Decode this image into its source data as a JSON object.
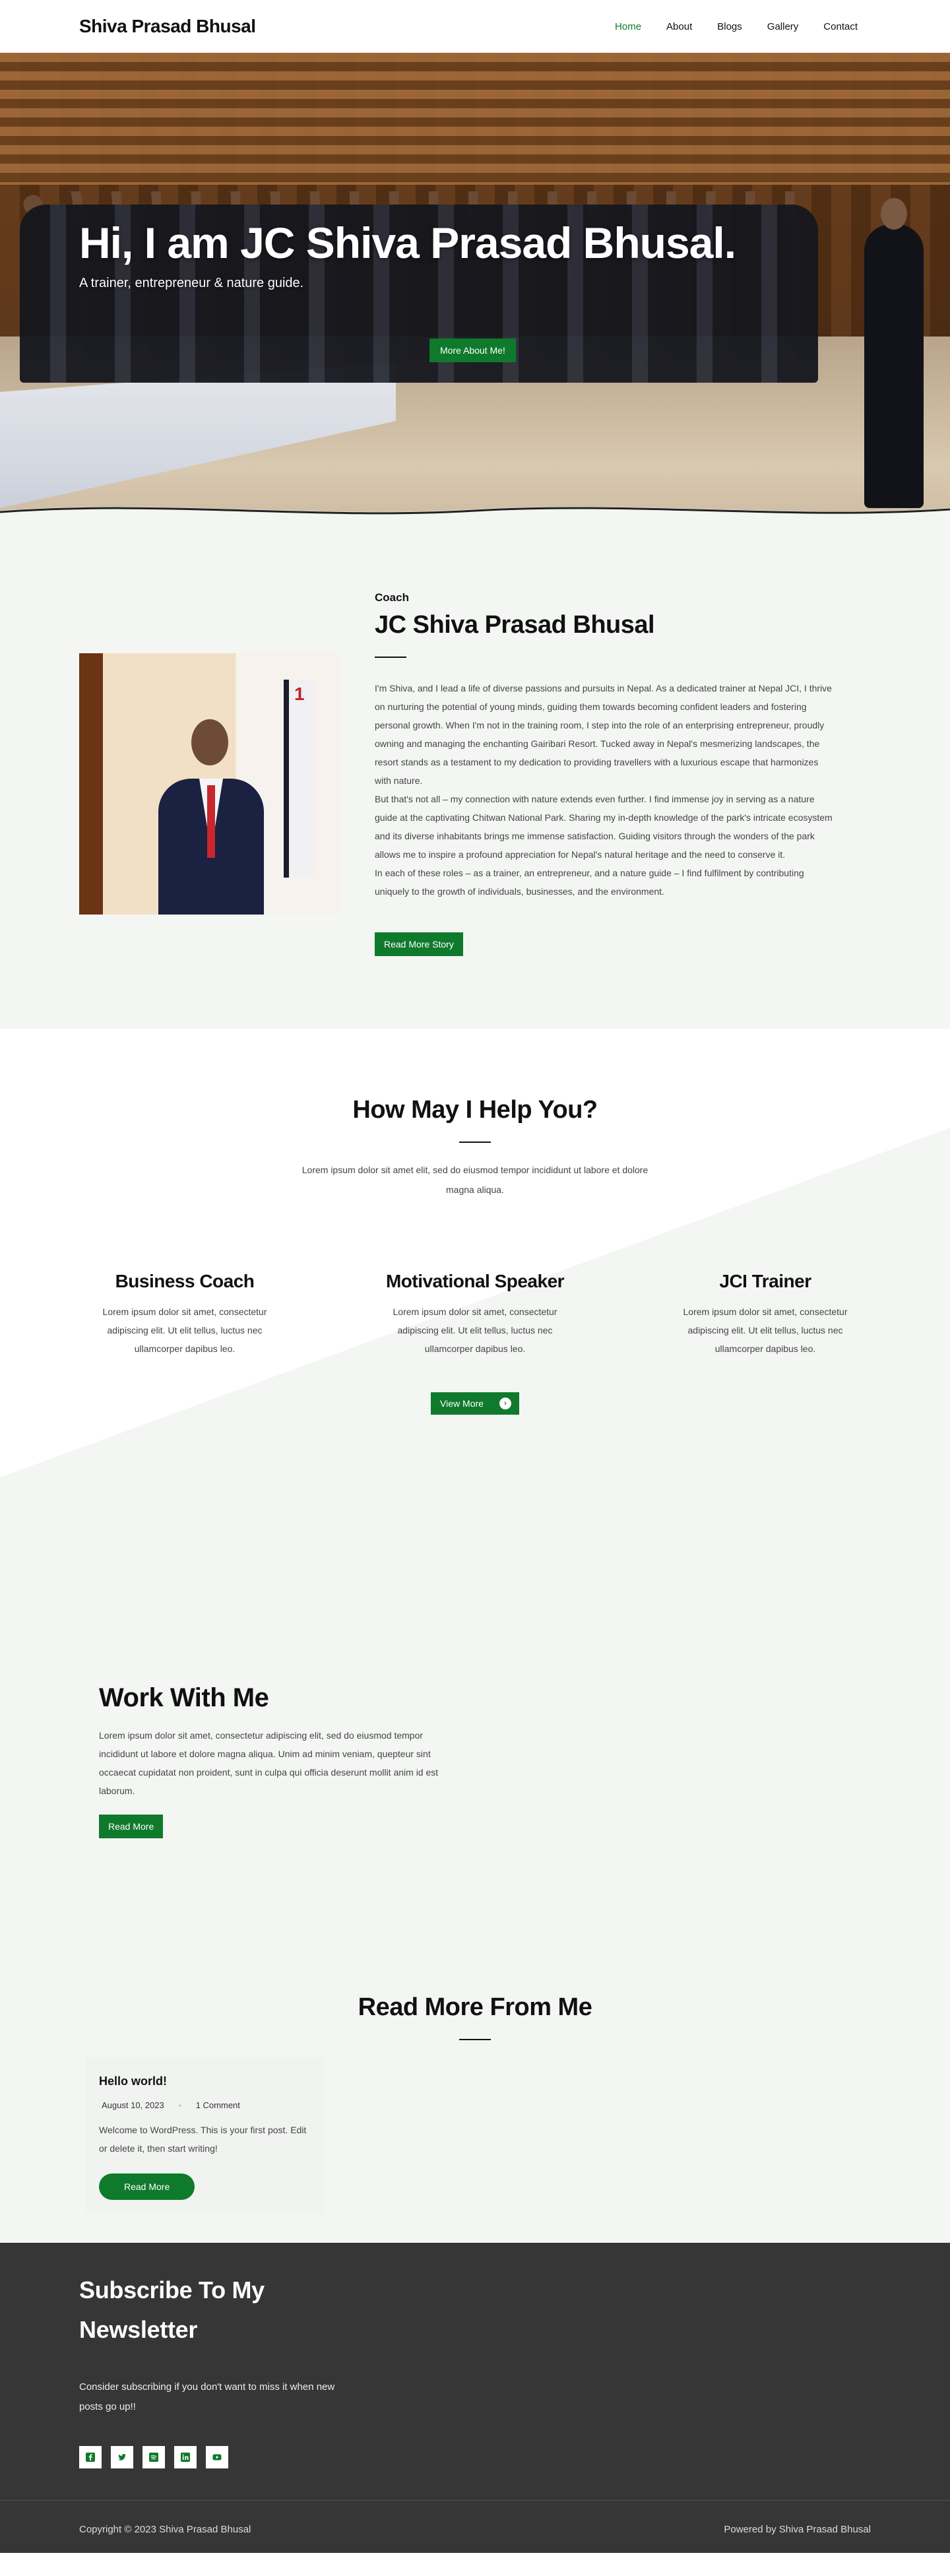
{
  "header": {
    "brand": "Shiva Prasad Bhusal",
    "nav": [
      "Home",
      "About",
      "Blogs",
      "Gallery",
      "Contact"
    ]
  },
  "hero": {
    "title": "Hi, I am JC Shiva Prasad Bhusal.",
    "subtitle": "A trainer, entrepreneur & nature guide.",
    "button": "More About Me!"
  },
  "about": {
    "kicker": "Coach",
    "title": "JC Shiva Prasad Bhusal",
    "paragraphs": [
      "I'm Shiva, and I lead a life of diverse passions and pursuits in Nepal. As a dedicated trainer at Nepal JCI, I thrive on nurturing the potential of young minds, guiding them towards becoming confident leaders and fostering personal growth. When I'm not in the training room, I step into the role of an enterprising entrepreneur, proudly owning and managing the enchanting Gairibari Resort. Tucked away in Nepal's mesmerizing landscapes, the resort stands as a testament to my dedication to providing travellers with a luxurious escape that harmonizes with nature.",
      "But that's not all – my connection with nature extends even further. I find immense joy in serving as a nature guide at the captivating Chitwan National Park. Sharing my in-depth knowledge of the park's intricate ecosystem and its diverse inhabitants brings me immense satisfaction. Guiding visitors through the wonders of the park allows me to inspire a profound appreciation for Nepal's natural heritage and the need to conserve it.",
      "In each of these roles – as a trainer, an entrepreneur, and a nature guide – I find fulfilment by contributing uniquely to the growth of individuals, businesses, and the environment."
    ],
    "button": "Read More Story"
  },
  "help": {
    "title": "How May I Help You?",
    "description": "Lorem ipsum dolor sit amet elit, sed do eiusmod tempor incididunt ut labore et dolore magna aliqua.",
    "services": [
      {
        "title": "Business Coach",
        "text": "Lorem ipsum dolor sit amet, consectetur adipiscing elit. Ut elit tellus, luctus nec ullamcorper dapibus leo."
      },
      {
        "title": "Motivational Speaker",
        "text": "Lorem ipsum dolor sit amet, consectetur adipiscing elit. Ut elit tellus, luctus nec ullamcorper dapibus leo."
      },
      {
        "title": "JCI Trainer",
        "text": "Lorem ipsum dolor sit amet, consectetur adipiscing elit. Ut elit tellus, luctus nec ullamcorper dapibus leo."
      }
    ],
    "button": "View More"
  },
  "work": {
    "title": "Work With Me",
    "text": "Lorem ipsum dolor sit amet, consectetur adipiscing elit, sed do eiusmod tempor incididunt ut labore et dolore magna aliqua. Unim ad minim veniam, quepteur sint occaecat cupidatat non proident, sunt in culpa qui officia deserunt mollit anim id est laborum.",
    "button": "Read More"
  },
  "blog": {
    "title": "Read More From Me",
    "post": {
      "title": "Hello world!",
      "date": "August 10, 2023",
      "comments": "1 Comment",
      "excerpt": "Welcome to WordPress. This is your first post. Edit or delete it, then start writing!",
      "button": "Read More"
    }
  },
  "footer": {
    "title": "Subscribe To My Newsletter",
    "subtitle": "Consider subscribing if you don't want to miss it when new posts go up!!",
    "socials": [
      "facebook-icon",
      "twitter-icon",
      "spotify-icon",
      "linkedin-icon",
      "youtube-icon"
    ],
    "copyright": "Copyright © 2023 Shiva Prasad Bhusal",
    "powered": "Powered by Shiva Prasad Bhusal"
  },
  "colors": {
    "accent": "#0f7a2c",
    "footer_bg": "#363636",
    "section_bg": "#f4f6f4"
  }
}
